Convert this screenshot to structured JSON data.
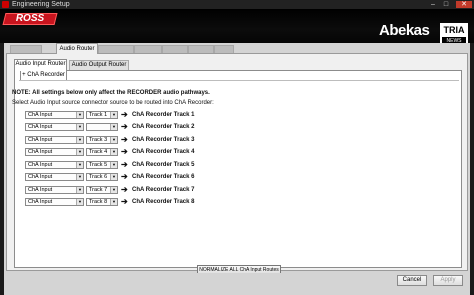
{
  "window": {
    "title": "Engineering Setup",
    "minimize": "–",
    "maximize": "□",
    "close": "✕"
  },
  "branding": {
    "ross": "ROSS",
    "abekas": "Abekas",
    "tria": "TRIA",
    "tria_sub": "NEWS"
  },
  "main_tabs": {
    "active": "Audio Router"
  },
  "sub_tabs": [
    "Audio Input Router",
    "Audio Output Router"
  ],
  "channel_tab": "+ ChA Recorder",
  "note": "NOTE: All settings below only affect the RECORDER audio pathways.",
  "instruction": "Select Audio Input source connector source to be routed into ChA Recorder:",
  "routes": [
    {
      "source": "ChA Input",
      "track": "Track 1",
      "dest": "ChA Recorder Track 1"
    },
    {
      "source": "ChA Input",
      "track": "",
      "dest": "ChA Recorder Track 2"
    },
    {
      "source": "ChA Input",
      "track": "Track 3",
      "dest": "ChA Recorder Track 3"
    },
    {
      "source": "ChA Input",
      "track": "Track 4",
      "dest": "ChA Recorder Track 4"
    },
    {
      "source": "ChA Input",
      "track": "Track 5",
      "dest": "ChA Recorder Track 5"
    },
    {
      "source": "ChA Input",
      "track": "Track 6",
      "dest": "ChA Recorder Track 6"
    },
    {
      "source": "ChA Input",
      "track": "Track 7",
      "dest": "ChA Recorder Track 7"
    },
    {
      "source": "ChA Input",
      "track": "Track 8",
      "dest": "ChA Recorder Track 8"
    }
  ],
  "arrow_glyph": "➔",
  "dropdown_glyph": "▼",
  "normalize_button": "NORMALIZE ALL ChA Input Routes",
  "footer": {
    "cancel": "Cancel",
    "apply": "Apply"
  }
}
